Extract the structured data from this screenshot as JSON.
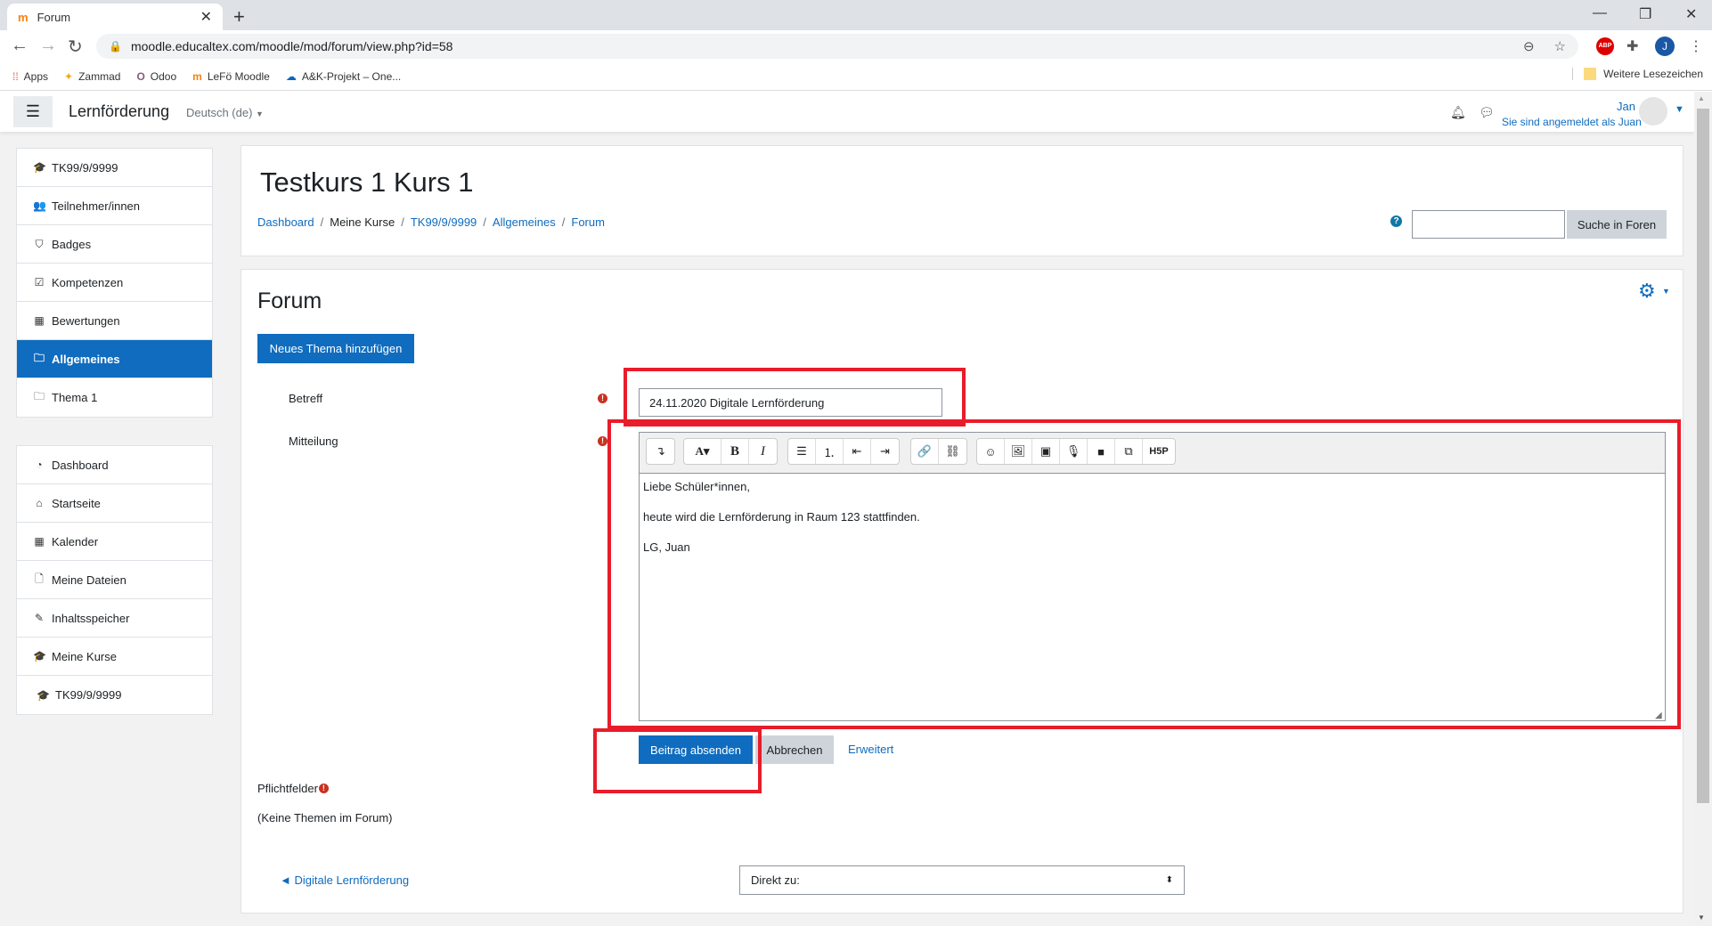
{
  "browser": {
    "tab_title": "Forum",
    "url": "moodle.educaltex.com/moodle/mod/forum/view.php?id=58",
    "profile_initial": "J",
    "extension_abp": "ABP",
    "bookmarks": [
      {
        "label": "Apps",
        "icon": "apps-grid-icon"
      },
      {
        "label": "Zammad",
        "icon": "zammad-icon"
      },
      {
        "label": "Odoo",
        "icon": "odoo-icon"
      },
      {
        "label": "LeFö Moodle",
        "icon": "moodle-icon"
      },
      {
        "label": "A&K-Projekt – One...",
        "icon": "onedrive-icon"
      }
    ],
    "other_bookmarks": "Weitere Lesezeichen"
  },
  "navbar": {
    "brand": "Lernförderung",
    "language": "Deutsch (de)",
    "user_name": "Jan",
    "logged_in_as": "Sie sind angemeldet als Juan"
  },
  "sidebar": {
    "course_items": [
      {
        "label": "TK99/9/9999",
        "icon": "graduation-cap-icon",
        "glyph": "🎓",
        "active": false
      },
      {
        "label": "Teilnehmer/innen",
        "icon": "users-icon",
        "glyph": "👥",
        "active": false
      },
      {
        "label": "Badges",
        "icon": "shield-icon",
        "glyph": "⛉",
        "active": false
      },
      {
        "label": "Kompetenzen",
        "icon": "check-square-icon",
        "glyph": "☑",
        "active": false
      },
      {
        "label": "Bewertungen",
        "icon": "table-icon",
        "glyph": "▦",
        "active": false
      },
      {
        "label": "Allgemeines",
        "icon": "folder-icon",
        "glyph": "🗀",
        "active": true
      },
      {
        "label": "Thema 1",
        "icon": "folder-icon",
        "glyph": "🗀",
        "active": false
      }
    ],
    "site_items": [
      {
        "label": "Dashboard",
        "icon": "tachometer-icon",
        "glyph": "◔"
      },
      {
        "label": "Startseite",
        "icon": "home-icon",
        "glyph": "⌂"
      },
      {
        "label": "Kalender",
        "icon": "calendar-icon",
        "glyph": "▦"
      },
      {
        "label": "Meine Dateien",
        "icon": "file-icon",
        "glyph": "🗋"
      },
      {
        "label": "Inhaltsspeicher",
        "icon": "paintbrush-icon",
        "glyph": "✎"
      },
      {
        "label": "Meine Kurse",
        "icon": "graduation-cap-icon",
        "glyph": "🎓"
      },
      {
        "label": "TK99/9/9999",
        "icon": "graduation-cap-icon",
        "glyph": "🎓"
      }
    ]
  },
  "header": {
    "course_title": "Testkurs 1 Kurs 1",
    "breadcrumb": [
      {
        "label": "Dashboard",
        "link": true
      },
      {
        "label": "Meine Kurse",
        "link": false
      },
      {
        "label": "TK99/9/9999",
        "link": true
      },
      {
        "label": "Allgemeines",
        "link": true
      },
      {
        "label": "Forum",
        "link": true
      }
    ],
    "search_value": "",
    "search_button": "Suche in Foren"
  },
  "main": {
    "title": "Forum",
    "new_topic_button": "Neues Thema hinzufügen",
    "form": {
      "subject_label": "Betreff",
      "subject_value": "24.11.2020 Digitale Lernförderung",
      "message_label": "Mitteilung",
      "message_lines": [
        "Liebe Schüler*innen,",
        "heute wird die Lernförderung in Raum 123 stattfinden.",
        "LG, Juan"
      ],
      "toolbar_groups": [
        [
          {
            "name": "show-more-icon",
            "glyph": "↴"
          }
        ],
        [
          {
            "name": "font-style-icon",
            "glyph": "A▾"
          },
          {
            "name": "bold-icon",
            "glyph": "B"
          },
          {
            "name": "italic-icon",
            "glyph": "I"
          }
        ],
        [
          {
            "name": "bullet-list-icon",
            "glyph": "☰"
          },
          {
            "name": "numbered-list-icon",
            "glyph": "⒈"
          },
          {
            "name": "outdent-icon",
            "glyph": "⇤"
          },
          {
            "name": "indent-icon",
            "glyph": "⇥"
          }
        ],
        [
          {
            "name": "link-icon",
            "glyph": "🔗"
          },
          {
            "name": "unlink-icon",
            "glyph": "⛓"
          }
        ],
        [
          {
            "name": "emoticon-icon",
            "glyph": "☺"
          },
          {
            "name": "image-icon",
            "glyph": "🖼"
          },
          {
            "name": "media-icon",
            "glyph": "▣"
          },
          {
            "name": "record-audio-icon",
            "glyph": "🎙"
          },
          {
            "name": "record-video-icon",
            "glyph": "■"
          },
          {
            "name": "manage-files-icon",
            "glyph": "⧉"
          },
          {
            "name": "h5p-icon",
            "glyph": "H5P"
          }
        ]
      ],
      "submit_button": "Beitrag absenden",
      "cancel_button": "Abbrechen",
      "advanced_link": "Erweitert",
      "required_note": "Pflichtfelder"
    },
    "no_topics": "(Keine Themen im Forum)",
    "prev_activity_link": "◄ Digitale Lernförderung",
    "jump_to_select": "Direkt zu:"
  },
  "colors": {
    "primary": "#0f6cbf",
    "annotation_red": "#e81c2a",
    "required_red": "#ca3120"
  }
}
